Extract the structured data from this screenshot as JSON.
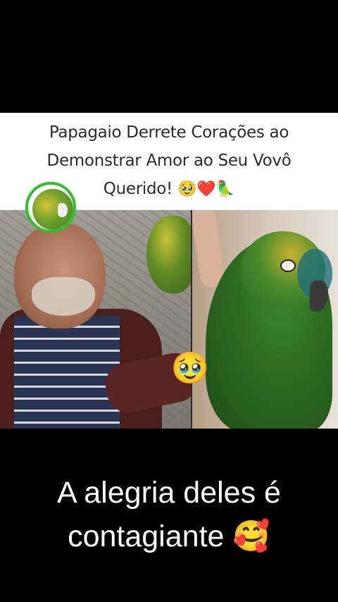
{
  "title": {
    "line1": "Papagaio Derrete Corações ao",
    "line2": "Demonstrar Amor ao Seu Vovô",
    "line3_text": "Querido! ",
    "line3_emojis": "🥹❤️🦜"
  },
  "overlay": {
    "emoji": "🥹"
  },
  "caption": {
    "line1": "A alegria deles é",
    "line2": "contagiante 🥰"
  },
  "colors": {
    "avatar_ring": "#2fbf2f",
    "title_text": "#2b2b2b",
    "caption_text": "#ffffff",
    "background": "#000000"
  }
}
